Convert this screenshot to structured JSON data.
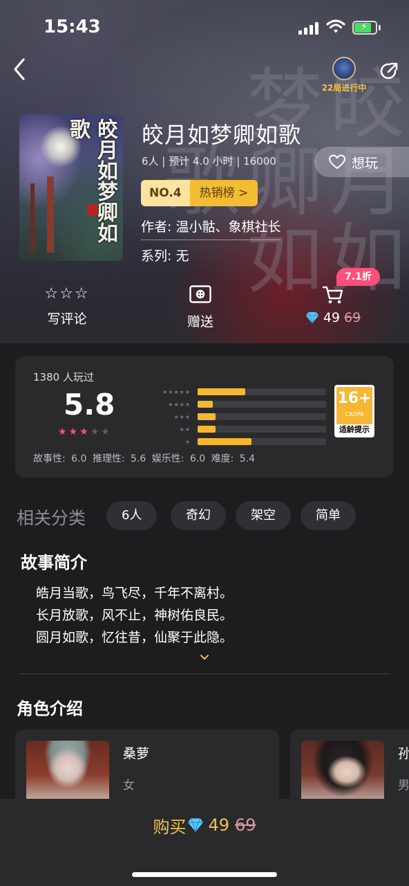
{
  "status": {
    "time": "15:43"
  },
  "header": {
    "games_running": "22局进行中"
  },
  "game": {
    "title": "皎月如梦卿如歌",
    "meta": "6人 | 预计 4.0 小时 | 16000",
    "want_label": "想玩",
    "rank_no": "NO.4",
    "rank_list": "热销榜 >",
    "authors": "作者: 温小骷、象棋社长",
    "series": "系列: 无",
    "cover_calligraphy": "皎月如梦卿如歌"
  },
  "actions": {
    "review": "写评论",
    "gift": "赠送",
    "discount": "7.1折",
    "price": "49",
    "original_price": "69"
  },
  "rating": {
    "played": "1380 人玩过",
    "score": "5.8",
    "stars_filled": 3,
    "stars_total": 5,
    "distribution": [
      {
        "stars": "★★★★★",
        "fraction": 0.37
      },
      {
        "stars": "★★★★",
        "fraction": 0.12
      },
      {
        "stars": "★★★",
        "fraction": 0.14
      },
      {
        "stars": "★★",
        "fraction": 0.14
      },
      {
        "stars": "★",
        "fraction": 0.42
      }
    ],
    "age_rating": "16+",
    "age_org": "CADPA",
    "age_tip": "适龄提示",
    "subscores": "故事性: 6.0 推理性: 5.6 娱乐性: 6.0 难度: 5.4"
  },
  "categories": {
    "title": "相关分类",
    "tags": [
      "6人",
      "奇幻",
      "架空",
      "简单"
    ]
  },
  "story": {
    "title": "故事简介",
    "lines": [
      "皓月当歌，鸟飞尽，千年不离村。",
      "长月放歌，风不止，神树佑良民。",
      "圆月如歌，忆往昔，仙聚于此隐。"
    ]
  },
  "characters": {
    "title": "角色介绍",
    "items": [
      {
        "name": "桑萝",
        "gender": "女"
      },
      {
        "name": "孙",
        "gender": "男"
      }
    ]
  },
  "buy": {
    "label": "购买",
    "price": "49",
    "original_price": "69"
  },
  "colors": {
    "accent": "#f7b731",
    "pink": "#ff4f7b",
    "gold_text": "#f3c14d"
  }
}
